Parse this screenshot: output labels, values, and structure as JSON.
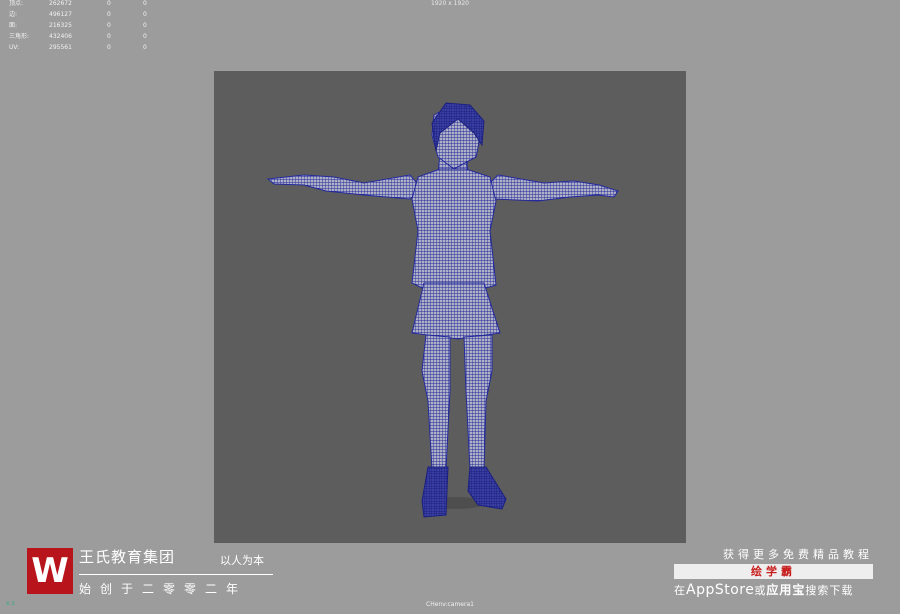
{
  "hud": {
    "rows": [
      {
        "label": "顶点:",
        "v1": "262672",
        "v2": "0",
        "v3": "0"
      },
      {
        "label": "边:",
        "v1": "496127",
        "v2": "0",
        "v3": "0"
      },
      {
        "label": "面:",
        "v1": "216325",
        "v2": "0",
        "v3": "0"
      },
      {
        "label": "三角形:",
        "v1": "432406",
        "v2": "0",
        "v3": "0"
      },
      {
        "label": "UV:",
        "v1": "295561",
        "v2": "0",
        "v3": "0"
      }
    ]
  },
  "resolution_label": "1920 x 1920",
  "camera_label": "CHenv:camera1",
  "axis_label": "x z",
  "brand": {
    "logo_letter": "W",
    "name": "王氏教育集团",
    "slogan": "以人为本",
    "subtitle": "始创于二零零二年"
  },
  "promo": {
    "top": "获得更多免费精品教程",
    "app_name": "绘学霸",
    "bottom_prefix": "在",
    "bottom_store": "AppStore",
    "bottom_or": "或",
    "bottom_app_store2": "应用宝",
    "bottom_suffix": "搜索下载"
  },
  "colors": {
    "background": "#9c9c9c",
    "viewport": "#5d5d5d",
    "wireframe": "#2a2f9e",
    "logo_red": "#b8141c"
  }
}
